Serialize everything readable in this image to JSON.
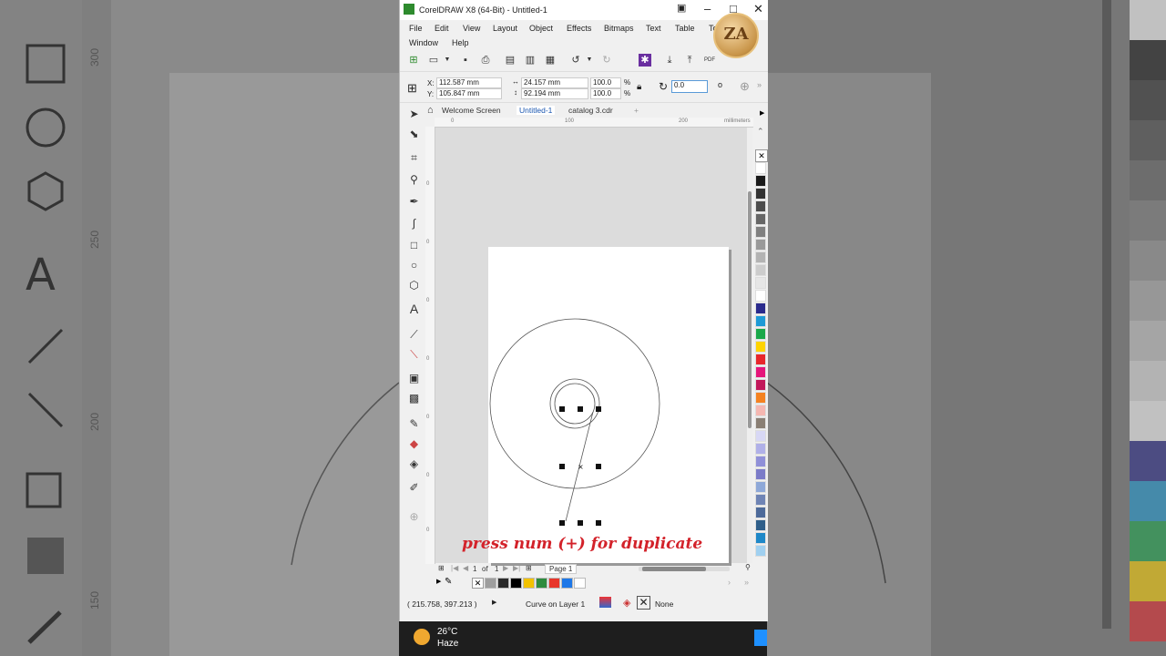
{
  "window": {
    "title": "CorelDRAW X8 (64-Bit) - Untitled-1",
    "brand_logo_text": "ZA"
  },
  "menu": [
    {
      "label": "File"
    },
    {
      "label": "Edit"
    },
    {
      "label": "View"
    },
    {
      "label": "Layout"
    },
    {
      "label": "Object"
    },
    {
      "label": "Effects"
    },
    {
      "label": "Bitmaps"
    },
    {
      "label": "Text"
    },
    {
      "label": "Table"
    },
    {
      "label": "Tools"
    },
    {
      "label": "Window"
    },
    {
      "label": "Help"
    }
  ],
  "toolbar": {
    "pdf_label": "PDF"
  },
  "propbar": {
    "x_label": "X:",
    "x_value": "112.587 mm",
    "y_label": "Y:",
    "y_value": "105.847 mm",
    "w_value": "24.157 mm",
    "h_value": "92.194 mm",
    "scale_w": "100.0",
    "scale_h": "100.0",
    "percent_sign": "%",
    "rotation": "0.0"
  },
  "doctabs": [
    {
      "label": "Welcome Screen",
      "active": false
    },
    {
      "label": "Untitled-1",
      "active": true
    },
    {
      "label": "catalog 3.cdr",
      "active": false
    }
  ],
  "ruler": {
    "h_ticks": [
      "0",
      "100",
      "200"
    ],
    "h_unit": "millimeters",
    "v_ticks": [
      "0",
      "0",
      "0",
      "0",
      "0",
      "0",
      "0"
    ]
  },
  "background": {
    "ruler_ticks": [
      "300",
      "250",
      "200",
      "150"
    ]
  },
  "caption": "press num (+) for duplicate",
  "pagenav": {
    "current": "1",
    "of_label": "of",
    "total": "1",
    "page_tab": "Page 1"
  },
  "status": {
    "cursor": "( 215.758, 397.213 )",
    "object_info": "Curve on Layer 1",
    "fill": "None"
  },
  "taskbar": {
    "temperature": "26°C",
    "weather": "Haze"
  },
  "colors": {
    "caption": "#d3222a",
    "title_logo": "#2e8b2e",
    "active_tab": "#1a56b0"
  },
  "palette": [
    "#ffffff",
    "#1a1a1a",
    "#333333",
    "#4d4d4d",
    "#666666",
    "#808080",
    "#999999",
    "#b3b3b3",
    "#cccccc",
    "#e6e6e6",
    "#ffffff",
    "#2a2a8c",
    "#1e9ad6",
    "#1aa84a",
    "#ffd400",
    "#e8262b",
    "#e5157a",
    "#c2185b",
    "#f58220",
    "#f5b7b1",
    "#8a7f74",
    "#d8d8f5",
    "#b0b0e8",
    "#9090d8",
    "#7b7bc8",
    "#8ea8d8",
    "#6f84b5",
    "#4d6a9a",
    "#2f5f8a",
    "#1e88c8",
    "#a0d0f0"
  ],
  "doc_palette": [
    "#9e9e9e",
    "#2b2b2b",
    "#000000",
    "#f2c200",
    "#2e8b3e",
    "#e8362b",
    "#1e78e8",
    "#ffffff"
  ]
}
